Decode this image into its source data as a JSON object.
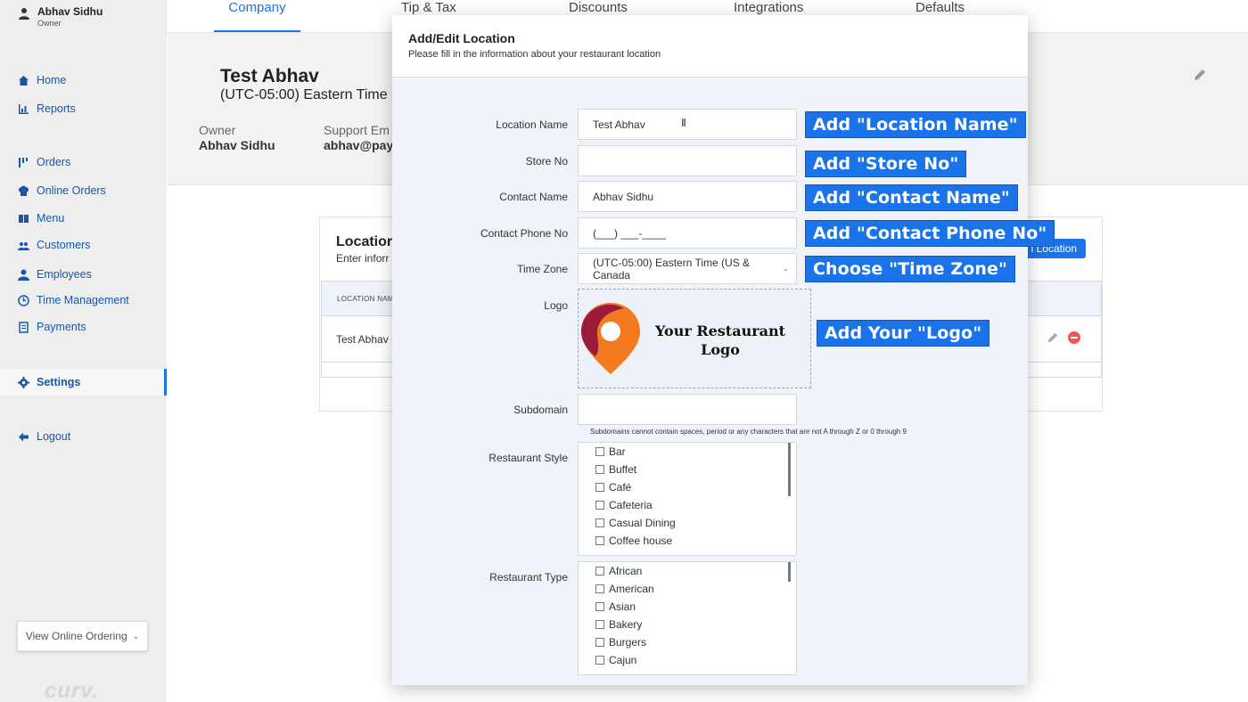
{
  "sidebar": {
    "user_name": "Abhav Sidhu",
    "user_role": "Owner",
    "items": [
      {
        "label": "Home",
        "icon": "home-icon"
      },
      {
        "label": "Reports",
        "icon": "chart-icon"
      },
      {
        "label": "Orders",
        "icon": "orders-icon"
      },
      {
        "label": "Online Orders",
        "icon": "chef-hat-icon"
      },
      {
        "label": "Menu",
        "icon": "book-icon"
      },
      {
        "label": "Customers",
        "icon": "people-icon"
      },
      {
        "label": "Employees",
        "icon": "person-icon"
      },
      {
        "label": "Time Management",
        "icon": "clock-icon"
      },
      {
        "label": "Payments",
        "icon": "receipt-icon"
      },
      {
        "label": "Settings",
        "icon": "gear-icon"
      },
      {
        "label": "Logout",
        "icon": "arrow-left-icon"
      }
    ],
    "view_online_ordering": "View Online Ordering",
    "brand": "curv."
  },
  "tabs": [
    "Company",
    "Tip & Tax",
    "Discounts",
    "Integrations",
    "Defaults"
  ],
  "company": {
    "name": "Test Abhav",
    "timezone": "(UTC-05:00) Eastern Time",
    "owner_label": "Owner",
    "owner_value": "Abhav Sidhu",
    "support_label": "Support Em",
    "support_value": "abhav@pay"
  },
  "locations": {
    "title": "Locatior",
    "subtitle": "Enter inforr",
    "add_button": "l Location",
    "column_header": "LOCATION NAM",
    "row_name": "Test Abhav"
  },
  "modal": {
    "title": "Add/Edit Location",
    "subtitle": "Please fill in the information about your restaurant location",
    "fields": {
      "location_name_label": "Location Name",
      "location_name_value": "Test Abhav",
      "store_no_label": "Store No",
      "store_no_value": "",
      "contact_name_label": "Contact Name",
      "contact_name_value": "Abhav Sidhu",
      "contact_phone_label": "Contact Phone No",
      "contact_phone_value": "(___) ___-____",
      "time_zone_label": "Time Zone",
      "time_zone_value": "(UTC-05:00) Eastern Time (US & Canada",
      "logo_label": "Logo",
      "logo_text": "Your Restaurant Logo",
      "subdomain_label": "Subdomain",
      "subdomain_value": "",
      "subdomain_hint": "Subdomains cannot contain spaces, period or any characters that are not A through Z or 0 through 9",
      "restaurant_style_label": "Restaurant Style",
      "restaurant_style_options": [
        "Bar",
        "Buffet",
        "Café",
        "Cafeteria",
        "Casual Dining",
        "Coffee house"
      ],
      "restaurant_type_label": "Restaurant Type",
      "restaurant_type_options": [
        "African",
        "American",
        "Asian",
        "Bakery",
        "Burgers",
        "Cajun"
      ]
    }
  },
  "callouts": [
    "Add \"Location Name\"",
    "Add \"Store No\"",
    "Add \"Contact Name\"",
    "Add \"Contact Phone No\"",
    "Choose \"Time Zone\"",
    "Add Your \"Logo\""
  ],
  "colors": {
    "accent": "#1a73e8",
    "logo_dark": "#9b1b3a",
    "logo_orange": "#f47a20"
  }
}
